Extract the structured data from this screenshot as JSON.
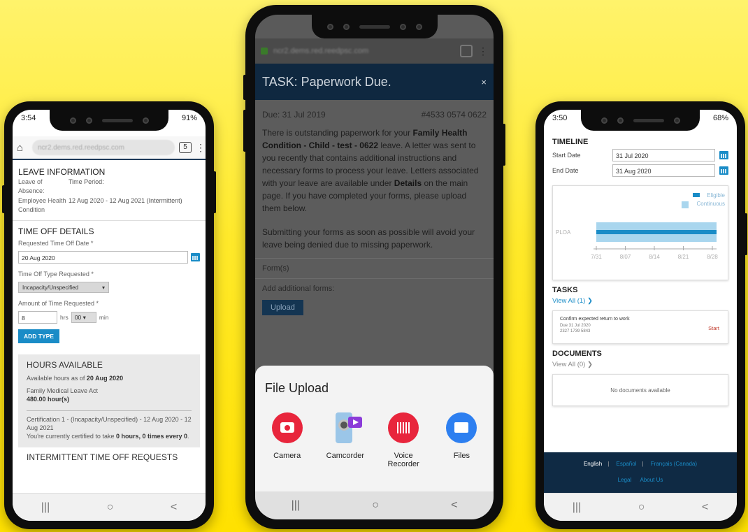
{
  "phone1": {
    "status": {
      "time": "3:54",
      "battery": "91%"
    },
    "browser": {
      "url": "ncr2.dems.red.reedpsc.com",
      "tabs_count": "5"
    },
    "leave_info": {
      "title": "LEAVE INFORMATION",
      "leave_label": "Leave of Absence:",
      "period_label": "Time Period:",
      "leave_value": "Employee Health Condition",
      "period_value": "12 Aug 2020 - 12 Aug 2021 (Intermittent)"
    },
    "time_off": {
      "title": "TIME OFF DETAILS",
      "date_label": "Requested Time Off Date *",
      "date_value": "20 Aug 2020",
      "type_label": "Time Off Type Requested *",
      "type_value": "Incapacity/Unspecified",
      "amount_label": "Amount of Time Requested *",
      "hours_value": "8",
      "hrs_unit": "hrs",
      "min_value": "00",
      "min_unit": "min",
      "add_button": "ADD TYPE"
    },
    "hours": {
      "title": "HOURS AVAILABLE",
      "asof_prefix": "Available hours as of",
      "asof_date": "20 Aug 2020",
      "act": "Family Medical Leave Act",
      "amount": "480.00 hour(s)",
      "cert": "Certification 1 - (Incapacity/Unspecified) - 12 Aug 2020 - 12 Aug 2021",
      "cert_prefix": "You're currently certified to take",
      "cert_value": "0 hours, 0 times every 0",
      "cert_suffix": "."
    },
    "intermittent_title": "INTERMITTENT TIME OFF REQUESTS"
  },
  "phone2": {
    "header": {
      "title": "TASK: Paperwork Due.",
      "close": "×"
    },
    "due": "Due: 31 Jul 2019",
    "ref": "#4533 0574 0622",
    "msg_1": "There is outstanding paperwork for your",
    "msg_bold_1": "Family Health Condition - Child - test - 0622",
    "msg_2": "leave. A letter was sent to you recently that contains additional instructions and necessary forms to process your leave. Letters associated with your leave are available under",
    "msg_bold_2": "Details",
    "msg_3": "on the main page. If you have completed your forms, please upload them below.",
    "msg_4": "Submitting your forms as soon as possible will avoid your leave being denied due to missing paperwork.",
    "forms_label": "Form(s)",
    "add_forms_label": "Add additional forms:",
    "upload_button": "Upload",
    "sheet": {
      "title": "File Upload",
      "apps": [
        {
          "label": "Camera"
        },
        {
          "label": "Camcorder"
        },
        {
          "label": "Voice Recorder"
        },
        {
          "label": "Files"
        }
      ]
    }
  },
  "phone3": {
    "status": {
      "time": "3:50",
      "battery": "68%"
    },
    "timeline": {
      "title": "TIMELINE",
      "start_label": "Start Date",
      "start_value": "31 Jul 2020",
      "end_label": "End Date",
      "end_value": "31 Aug 2020"
    },
    "chart_data": {
      "type": "bar",
      "orientation": "horizontal",
      "categories": [
        "PLOA"
      ],
      "x_ticks": [
        "7/31",
        "8/07",
        "8/14",
        "8/21",
        "8/28"
      ],
      "series": [
        {
          "name": "Eligible",
          "color": "#1a8cc7",
          "start": "7/31",
          "end": "8/31"
        },
        {
          "name": "Continuous",
          "color": "#a9d6ee",
          "start": "7/31",
          "end": "8/31"
        }
      ],
      "legend": "top-right"
    },
    "tasks": {
      "title": "TASKS",
      "view_all": "View All (1) ❯",
      "card_title": "Confirm expected return to work",
      "card_due": "Due 31 Jul 2020",
      "card_ref": "2327 1739 5843",
      "card_action": "Start"
    },
    "documents": {
      "title": "DOCUMENTS",
      "view_all": "View All (0) ❯",
      "empty": "No documents available"
    },
    "footer": {
      "english": "English",
      "espanol": "Español",
      "francais": "Français (Canada)",
      "legal": "Legal",
      "about": "About Us"
    }
  },
  "nav": {
    "recents": "|||",
    "home": "○",
    "back": "<"
  }
}
